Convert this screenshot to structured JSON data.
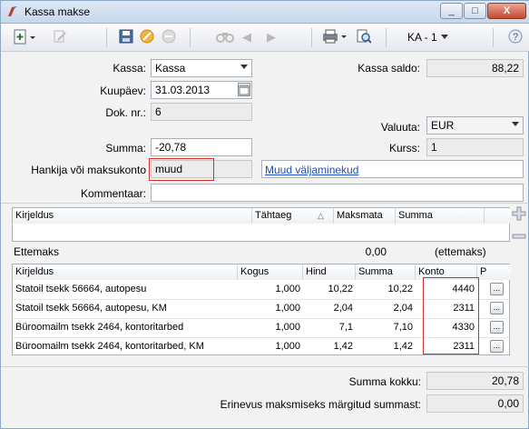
{
  "window": {
    "title": "Kassa makse",
    "minimize": "_",
    "maximize": "□",
    "close": "X"
  },
  "toolbar": {
    "doc_label": "KA - 1"
  },
  "form": {
    "kassa_label": "Kassa:",
    "kassa_value": "Kassa",
    "kassa_saldo_label": "Kassa saldo:",
    "kassa_saldo_value": "88,22",
    "kuupaev_label": "Kuupäev:",
    "kuupaev_value": "31.03.2013",
    "dok_nr_label": "Dok. nr.:",
    "dok_nr_value": "6",
    "valuuta_label": "Valuuta:",
    "valuuta_value": "EUR",
    "summa_label": "Summa:",
    "summa_value": "-20,78",
    "kurss_label": "Kurss:",
    "kurss_value": "1",
    "hankija_label": "Hankija või maksukonto",
    "hankija_value": "muud",
    "muud_link": "Muud väljaminekud",
    "kommentaar_label": "Kommentaar:",
    "kommentaar_value": ""
  },
  "invoice_grid": {
    "columns": [
      "Kirjeldus",
      "Tähtaeg",
      "Maksmata",
      "Summa"
    ],
    "sort_icon": "△"
  },
  "ettemaks": {
    "label": "Ettemaks",
    "value": "0,00",
    "suffix": "(ettemaks)"
  },
  "lines_grid": {
    "columns": [
      "Kirjeldus",
      "Kogus",
      "Hind",
      "Summa",
      "Konto",
      "P"
    ],
    "rows": [
      {
        "kirjeldus": "Statoil tsekk 56664, autopesu",
        "kogus": "1,000",
        "hind": "10,22",
        "summa": "10,22",
        "konto": "4440"
      },
      {
        "kirjeldus": "Statoil tsekk 56664, autopesu, KM",
        "kogus": "1,000",
        "hind": "2,04",
        "summa": "2,04",
        "konto": "2311"
      },
      {
        "kirjeldus": "Büroomailm tsekk 2464, kontoritarbed",
        "kogus": "1,000",
        "hind": "7,1",
        "summa": "7,10",
        "konto": "4330"
      },
      {
        "kirjeldus": "Büroomailm tsekk 2464, kontoritarbed, KM",
        "kogus": "1,000",
        "hind": "1,42",
        "summa": "1,42",
        "konto": "2311"
      }
    ],
    "row_button": "..."
  },
  "totals": {
    "summa_kokku_label": "Summa kokku:",
    "summa_kokku_value": "20,78",
    "erinevus_label": "Erinevus maksmiseks märgitud summast:",
    "erinevus_value": "0,00"
  },
  "colors": {
    "highlight": "#d0312d",
    "link": "#1a4fbf"
  }
}
